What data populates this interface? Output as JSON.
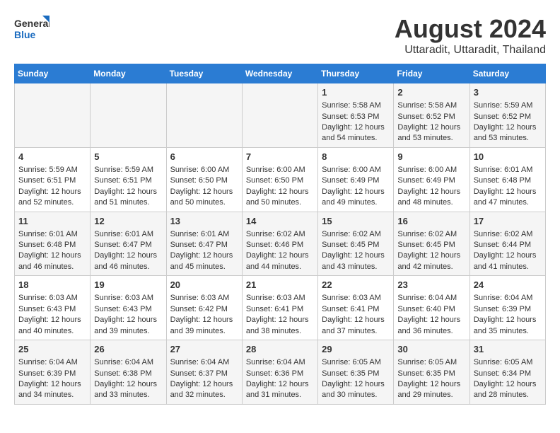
{
  "logo": {
    "line1": "General",
    "line2": "Blue"
  },
  "title": "August 2024",
  "subtitle": "Uttaradit, Uttaradit, Thailand",
  "days_header": [
    "Sunday",
    "Monday",
    "Tuesday",
    "Wednesday",
    "Thursday",
    "Friday",
    "Saturday"
  ],
  "weeks": [
    [
      {
        "day": "",
        "content": ""
      },
      {
        "day": "",
        "content": ""
      },
      {
        "day": "",
        "content": ""
      },
      {
        "day": "",
        "content": ""
      },
      {
        "day": "1",
        "content": "Sunrise: 5:58 AM\nSunset: 6:53 PM\nDaylight: 12 hours\nand 54 minutes."
      },
      {
        "day": "2",
        "content": "Sunrise: 5:58 AM\nSunset: 6:52 PM\nDaylight: 12 hours\nand 53 minutes."
      },
      {
        "day": "3",
        "content": "Sunrise: 5:59 AM\nSunset: 6:52 PM\nDaylight: 12 hours\nand 53 minutes."
      }
    ],
    [
      {
        "day": "4",
        "content": "Sunrise: 5:59 AM\nSunset: 6:51 PM\nDaylight: 12 hours\nand 52 minutes."
      },
      {
        "day": "5",
        "content": "Sunrise: 5:59 AM\nSunset: 6:51 PM\nDaylight: 12 hours\nand 51 minutes."
      },
      {
        "day": "6",
        "content": "Sunrise: 6:00 AM\nSunset: 6:50 PM\nDaylight: 12 hours\nand 50 minutes."
      },
      {
        "day": "7",
        "content": "Sunrise: 6:00 AM\nSunset: 6:50 PM\nDaylight: 12 hours\nand 50 minutes."
      },
      {
        "day": "8",
        "content": "Sunrise: 6:00 AM\nSunset: 6:49 PM\nDaylight: 12 hours\nand 49 minutes."
      },
      {
        "day": "9",
        "content": "Sunrise: 6:00 AM\nSunset: 6:49 PM\nDaylight: 12 hours\nand 48 minutes."
      },
      {
        "day": "10",
        "content": "Sunrise: 6:01 AM\nSunset: 6:48 PM\nDaylight: 12 hours\nand 47 minutes."
      }
    ],
    [
      {
        "day": "11",
        "content": "Sunrise: 6:01 AM\nSunset: 6:48 PM\nDaylight: 12 hours\nand 46 minutes."
      },
      {
        "day": "12",
        "content": "Sunrise: 6:01 AM\nSunset: 6:47 PM\nDaylight: 12 hours\nand 46 minutes."
      },
      {
        "day": "13",
        "content": "Sunrise: 6:01 AM\nSunset: 6:47 PM\nDaylight: 12 hours\nand 45 minutes."
      },
      {
        "day": "14",
        "content": "Sunrise: 6:02 AM\nSunset: 6:46 PM\nDaylight: 12 hours\nand 44 minutes."
      },
      {
        "day": "15",
        "content": "Sunrise: 6:02 AM\nSunset: 6:45 PM\nDaylight: 12 hours\nand 43 minutes."
      },
      {
        "day": "16",
        "content": "Sunrise: 6:02 AM\nSunset: 6:45 PM\nDaylight: 12 hours\nand 42 minutes."
      },
      {
        "day": "17",
        "content": "Sunrise: 6:02 AM\nSunset: 6:44 PM\nDaylight: 12 hours\nand 41 minutes."
      }
    ],
    [
      {
        "day": "18",
        "content": "Sunrise: 6:03 AM\nSunset: 6:43 PM\nDaylight: 12 hours\nand 40 minutes."
      },
      {
        "day": "19",
        "content": "Sunrise: 6:03 AM\nSunset: 6:43 PM\nDaylight: 12 hours\nand 39 minutes."
      },
      {
        "day": "20",
        "content": "Sunrise: 6:03 AM\nSunset: 6:42 PM\nDaylight: 12 hours\nand 39 minutes."
      },
      {
        "day": "21",
        "content": "Sunrise: 6:03 AM\nSunset: 6:41 PM\nDaylight: 12 hours\nand 38 minutes."
      },
      {
        "day": "22",
        "content": "Sunrise: 6:03 AM\nSunset: 6:41 PM\nDaylight: 12 hours\nand 37 minutes."
      },
      {
        "day": "23",
        "content": "Sunrise: 6:04 AM\nSunset: 6:40 PM\nDaylight: 12 hours\nand 36 minutes."
      },
      {
        "day": "24",
        "content": "Sunrise: 6:04 AM\nSunset: 6:39 PM\nDaylight: 12 hours\nand 35 minutes."
      }
    ],
    [
      {
        "day": "25",
        "content": "Sunrise: 6:04 AM\nSunset: 6:39 PM\nDaylight: 12 hours\nand 34 minutes."
      },
      {
        "day": "26",
        "content": "Sunrise: 6:04 AM\nSunset: 6:38 PM\nDaylight: 12 hours\nand 33 minutes."
      },
      {
        "day": "27",
        "content": "Sunrise: 6:04 AM\nSunset: 6:37 PM\nDaylight: 12 hours\nand 32 minutes."
      },
      {
        "day": "28",
        "content": "Sunrise: 6:04 AM\nSunset: 6:36 PM\nDaylight: 12 hours\nand 31 minutes."
      },
      {
        "day": "29",
        "content": "Sunrise: 6:05 AM\nSunset: 6:35 PM\nDaylight: 12 hours\nand 30 minutes."
      },
      {
        "day": "30",
        "content": "Sunrise: 6:05 AM\nSunset: 6:35 PM\nDaylight: 12 hours\nand 29 minutes."
      },
      {
        "day": "31",
        "content": "Sunrise: 6:05 AM\nSunset: 6:34 PM\nDaylight: 12 hours\nand 28 minutes."
      }
    ]
  ]
}
